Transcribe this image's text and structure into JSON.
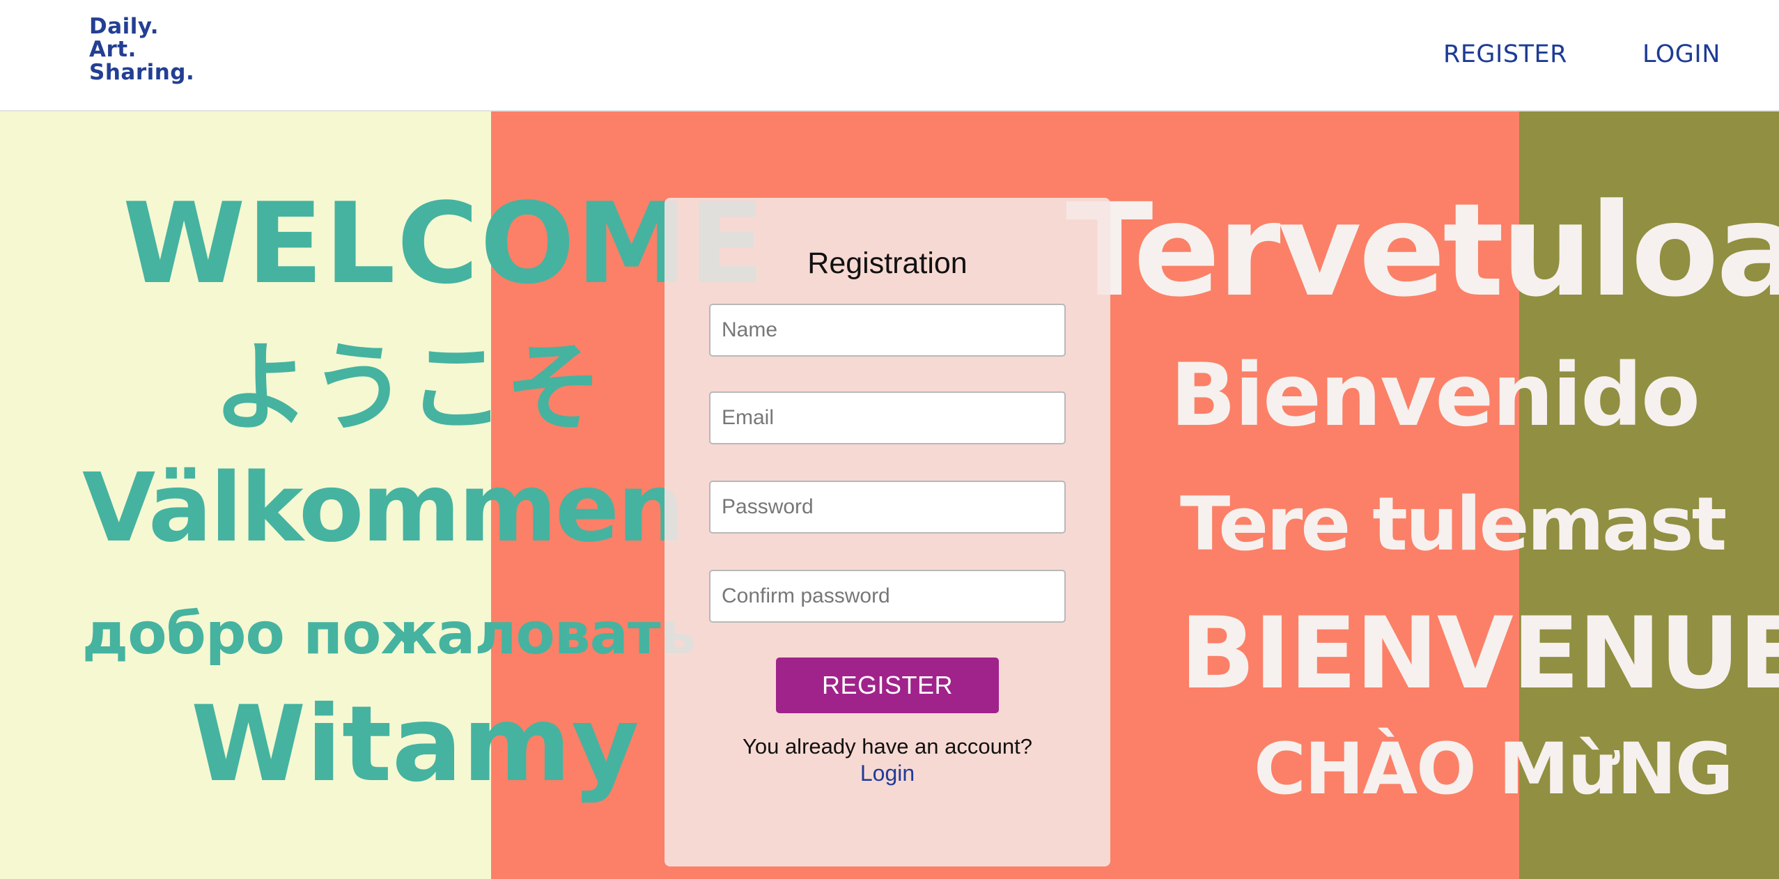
{
  "logo": {
    "line1": "Daily.",
    "line2": "Art.",
    "line3": "Sharing."
  },
  "nav": {
    "register_label": "REGISTER",
    "login_label": "LOGIN"
  },
  "welcome_words": {
    "welcome": "WELCOME",
    "youkoso": "ようこそ",
    "valkommen": "Välkommen",
    "dobro": "добро пожаловать",
    "witamy": "Witamy",
    "tervetuloa": "Tervetuloa",
    "bienvenido": "Bienvenido",
    "tere": "Tere tulemast",
    "bienvenue": "BIENVENUE",
    "chao": "CHÀO MừNG"
  },
  "form": {
    "title": "Registration",
    "name_placeholder": "Name",
    "email_placeholder": "Email",
    "password_placeholder": "Password",
    "confirm_placeholder": "Confirm password",
    "register_button": "REGISTER",
    "already_text": "You already have an account?",
    "login_link": "Login"
  },
  "colors": {
    "brand_blue": "#233f93",
    "teal_text": "#45b3a0",
    "cream_band": "#f6f8d2",
    "salmon_band": "#fb8067",
    "olive_band": "#918f41",
    "register_button": "#a0238b"
  }
}
